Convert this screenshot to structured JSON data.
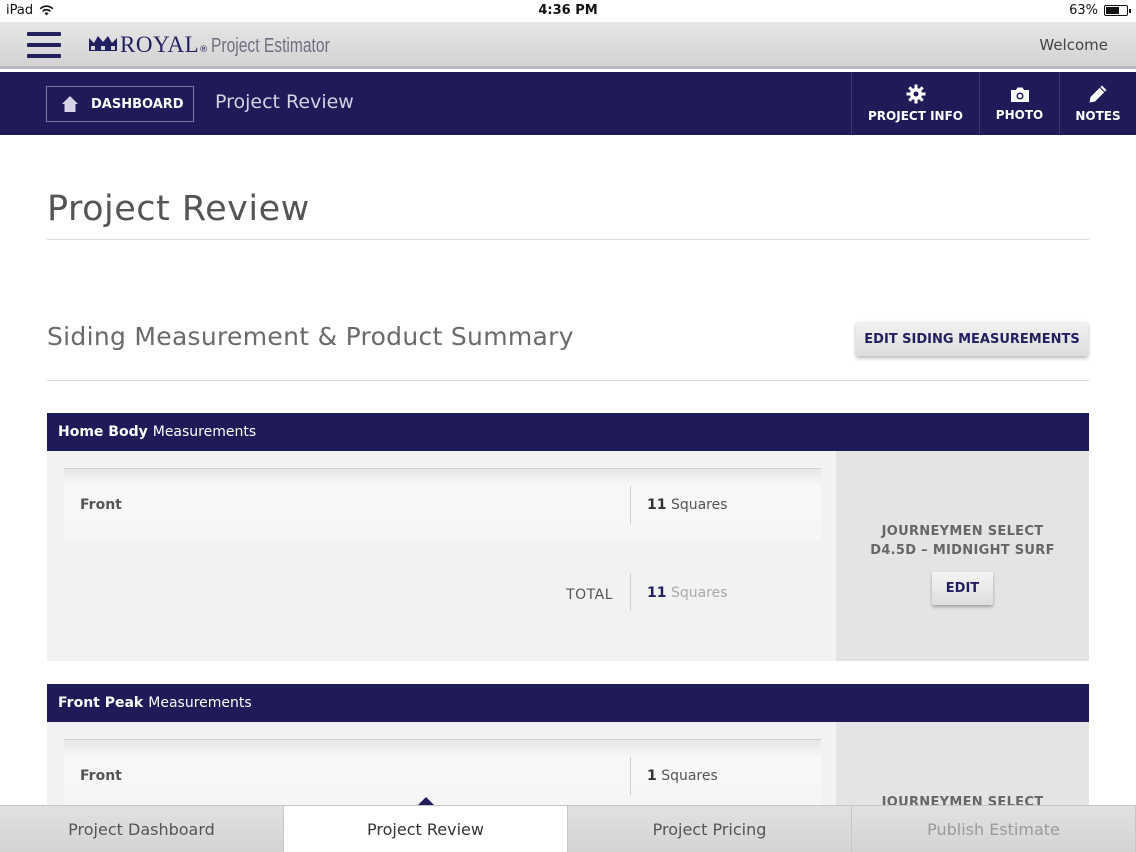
{
  "status_bar": {
    "device": "iPad",
    "time": "4:36 PM",
    "battery": "63%",
    "battery_level": 0.63
  },
  "header": {
    "brand": "ROYAL",
    "brand_mark": "®",
    "product": "Project Estimator",
    "welcome": "Welcome"
  },
  "navbar": {
    "dashboard_label": "DASHBOARD",
    "title": "Project Review",
    "actions": [
      {
        "label": "PROJECT INFO",
        "icon": "gear-icon"
      },
      {
        "label": "PHOTO",
        "icon": "camera-icon"
      },
      {
        "label": "NOTES",
        "icon": "pencil-icon"
      }
    ]
  },
  "page": {
    "title": "Project Review",
    "section_title": "Siding Measurement & Product Summary",
    "edit_siding_label": "EDIT SIDING MEASUREMENTS"
  },
  "blocks": [
    {
      "header_bold": "Home Body",
      "header_rest": "Measurements",
      "rows": [
        {
          "label": "Front",
          "value_num": "11",
          "value_unit": "Squares"
        }
      ],
      "total_label": "TOTAL",
      "total_num": "11",
      "total_unit": "Squares",
      "product_line1": "JOURNEYMEN SELECT",
      "product_line2": "D4.5D – MIDNIGHT SURF",
      "edit_label": "EDIT"
    },
    {
      "header_bold": "Front Peak",
      "header_rest": "Measurements",
      "rows": [
        {
          "label": "Front",
          "value_num": "1",
          "value_unit": "Squares"
        }
      ],
      "product_line1": "JOURNEYMEN SELECT"
    }
  ],
  "tabs": [
    {
      "label": "Project Dashboard",
      "state": "normal"
    },
    {
      "label": "Project Review",
      "state": "active"
    },
    {
      "label": "Project Pricing",
      "state": "normal"
    },
    {
      "label": "Publish Estimate",
      "state": "disabled"
    }
  ],
  "colors": {
    "brand_navy": "#1f1a58",
    "header_gray": "#d3d3d3",
    "panel_gray": "#f2f2f2"
  }
}
